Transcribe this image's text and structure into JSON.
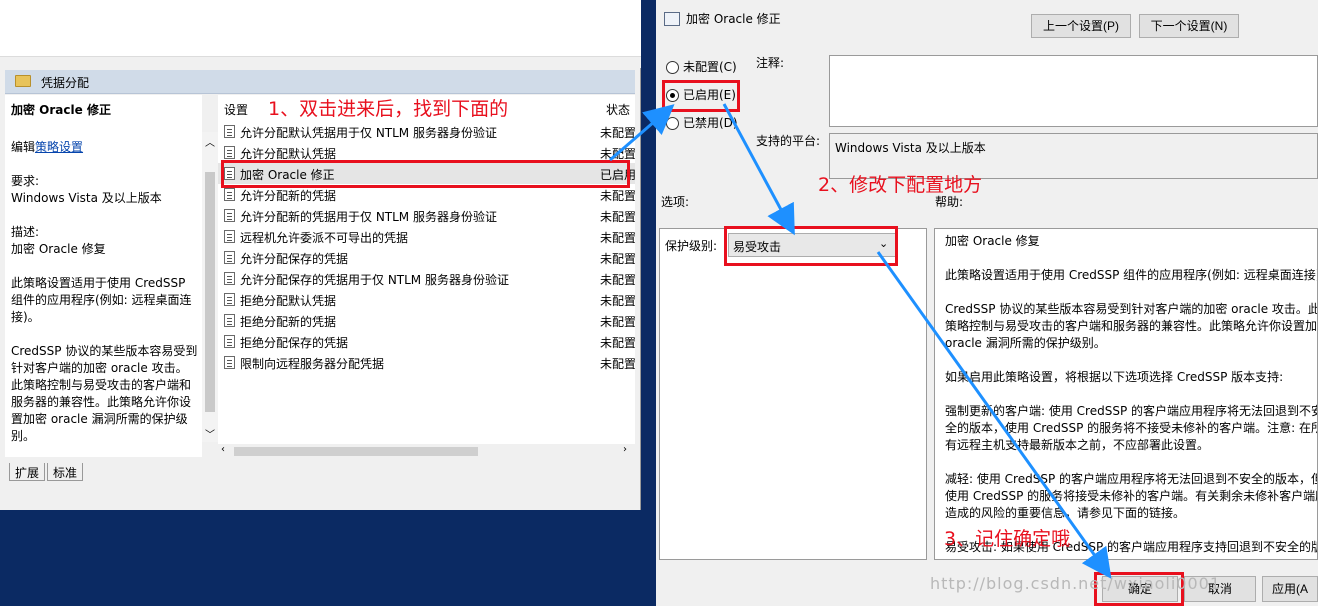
{
  "left_window": {
    "header_title": "凭据分配",
    "description": {
      "policy_title": "加密 Oracle 修正",
      "edit_prefix": "编辑",
      "edit_link": "策略设置",
      "requirements_label": "要求:",
      "requirements_value": "Windows Vista 及以上版本",
      "description_label": "描述:",
      "description_value": "加密 Oracle 修复",
      "body_lines": [
        "此策略设置适用于使用 CredSSP",
        "组件的应用程序(例如: 远程桌面连",
        "接)。",
        "",
        "CredSSP 协议的某些版本容易受到",
        "针对客户端的加密 oracle 攻击。",
        "此策略控制与易受攻击的客户端和",
        "服务器的兼容性。此策略允许你设",
        "置加密 oracle 漏洞所需的保护级",
        "别。"
      ]
    },
    "list": {
      "col_setting": "设置",
      "col_state": "状态",
      "rows": [
        {
          "name": "允许分配默认凭据用于仅 NTLM 服务器身份验证",
          "state": "未配置"
        },
        {
          "name": "允许分配默认凭据",
          "state": "未配置"
        },
        {
          "name": "加密 Oracle 修正",
          "state": "已启用"
        },
        {
          "name": "允许分配新的凭据",
          "state": "未配置"
        },
        {
          "name": "允许分配新的凭据用于仅 NTLM 服务器身份验证",
          "state": "未配置"
        },
        {
          "name": "远程机允许委派不可导出的凭据",
          "state": "未配置"
        },
        {
          "name": "允许分配保存的凭据",
          "state": "未配置"
        },
        {
          "name": "允许分配保存的凭据用于仅 NTLM 服务器身份验证",
          "state": "未配置"
        },
        {
          "name": "拒绝分配默认凭据",
          "state": "未配置"
        },
        {
          "name": "拒绝分配新的凭据",
          "state": "未配置"
        },
        {
          "name": "拒绝分配保存的凭据",
          "state": "未配置"
        },
        {
          "name": "限制向远程服务器分配凭据",
          "state": "未配置"
        }
      ]
    },
    "tabs": [
      "扩展",
      "标准"
    ]
  },
  "dialog": {
    "title": "加密 Oracle 修正",
    "prev_button": "上一个设置(P)",
    "next_button": "下一个设置(N)",
    "radio_not_configured": "未配置(C)",
    "radio_enabled": "已启用(E)",
    "radio_disabled": "已禁用(D)",
    "comment_label": "注释:",
    "supported_label": "支持的平台:",
    "supported_value": "Windows Vista 及以上版本",
    "options_label": "选项:",
    "help_label": "帮助:",
    "protect_label": "保护级别:",
    "protect_value": "易受攻击",
    "help_lines": [
      "加密 Oracle 修复",
      "",
      "此策略设置适用于使用 CredSSP 组件的应用程序(例如: 远程桌面连接)。",
      "",
      "CredSSP 协议的某些版本容易受到针对客户端的加密 oracle 攻击。此",
      "策略控制与易受攻击的客户端和服务器的兼容性。此策略允许你设置加密",
      "oracle 漏洞所需的保护级别。",
      "",
      "如果启用此策略设置，将根据以下选项选择 CredSSP 版本支持:",
      "",
      "强制更新的客户端: 使用 CredSSP 的客户端应用程序将无法回退到不安",
      "全的版本，使用 CredSSP 的服务将不接受未修补的客户端。注意: 在所",
      "有远程主机支持最新版本之前，不应部署此设置。",
      "",
      "减轻: 使用 CredSSP 的客户端应用程序将无法回退到不安全的版本，但",
      "使用 CredSSP 的服务将接受未修补的客户端。有关剩余未修补客户端所",
      "造成的风险的重要信息，请参见下面的链接。",
      "",
      "易受攻击: 如果使用 CredSSP 的客户端应用程序支持回退到不安全的版"
    ],
    "ok_button": "确定",
    "cancel_button": "取消",
    "apply_button": "应用(A"
  },
  "annotations": {
    "step1": "1、双击进来后，找到下面的",
    "step2": "2、修改下配置地方",
    "step3": "3、记住确定哦",
    "watermark": "http://blog.csdn.net/wxiaoli0001",
    "color": "#e8101e"
  }
}
